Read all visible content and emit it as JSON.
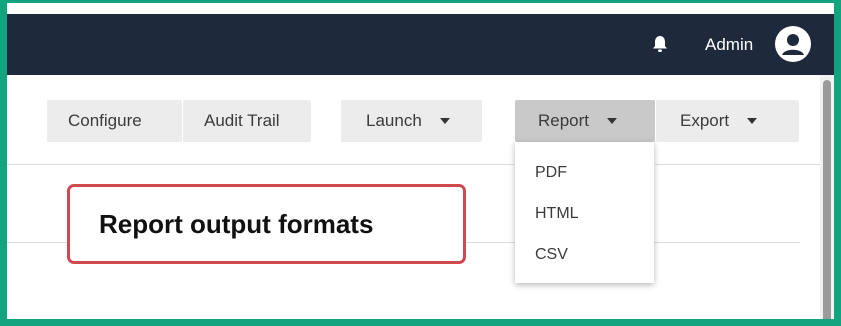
{
  "header": {
    "user_label": "Admin",
    "icons": {
      "notifications": "bell-icon",
      "user": "user-avatar-icon"
    }
  },
  "toolbar": {
    "configure_label": "Configure",
    "audit_trail_label": "Audit Trail",
    "launch_label": "Launch",
    "report_label": "Report",
    "export_label": "Export"
  },
  "report_menu": {
    "items": [
      {
        "label": "PDF"
      },
      {
        "label": "HTML"
      },
      {
        "label": "CSV"
      }
    ]
  },
  "callout": {
    "text": "Report output formats"
  },
  "colors": {
    "frame_border": "#12a37f",
    "topbar_bg": "#1e2a3b",
    "callout_border": "#cf4a4f",
    "active_button_bg": "#c9c9c9"
  }
}
